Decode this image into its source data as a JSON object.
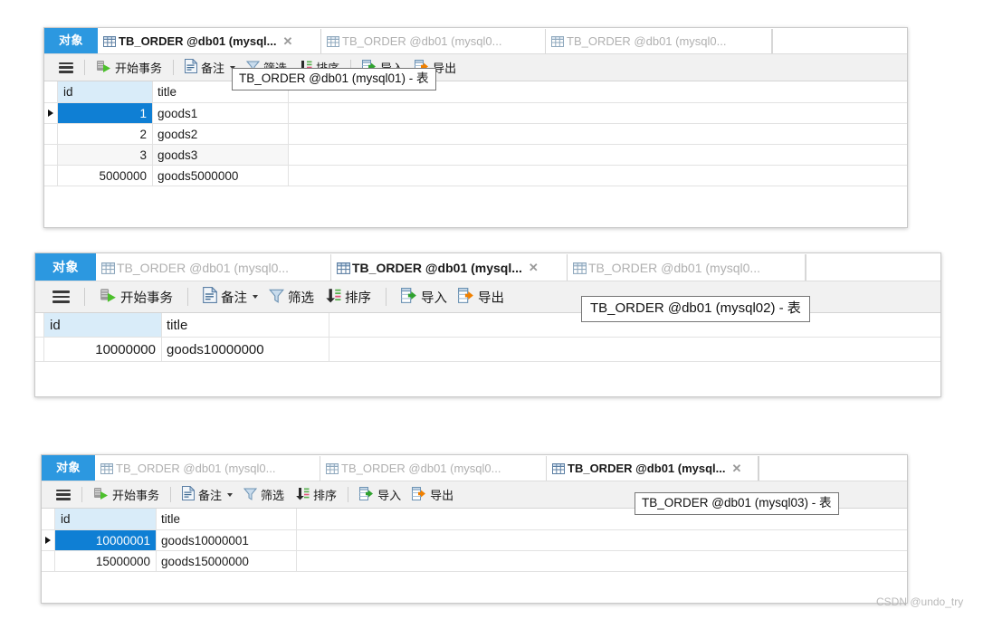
{
  "watermark": "CSDN @undo_try",
  "common": {
    "object_tab_label": "对象",
    "toolbar": {
      "menu_icon": "hamburger-menu-icon",
      "begin_transaction": "开始事务",
      "remark": "备注",
      "filter": "筛选",
      "sort": "排序",
      "import": "导入",
      "export": "导出"
    },
    "columns": [
      "id",
      "title"
    ]
  },
  "panels": [
    {
      "id": "panel-mysql01",
      "tabs": [
        {
          "label": "TB_ORDER @db01 (mysql...",
          "active": true,
          "closable": true
        },
        {
          "label": "TB_ORDER @db01 (mysql0...",
          "active": false,
          "closable": false
        },
        {
          "label": "TB_ORDER @db01 (mysql0...",
          "active": false,
          "closable": false
        }
      ],
      "tooltip": "TB_ORDER @db01 (mysql01) - 表",
      "rows": [
        {
          "id": "1",
          "title": "goods1",
          "selected": true
        },
        {
          "id": "2",
          "title": "goods2",
          "selected": false
        },
        {
          "id": "3",
          "title": "goods3",
          "selected": false
        },
        {
          "id": "5000000",
          "title": "goods5000000",
          "selected": false
        }
      ]
    },
    {
      "id": "panel-mysql02",
      "tabs": [
        {
          "label": "TB_ORDER @db01 (mysql0...",
          "active": false,
          "closable": false
        },
        {
          "label": "TB_ORDER @db01 (mysql...",
          "active": true,
          "closable": true
        },
        {
          "label": "TB_ORDER @db01 (mysql0...",
          "active": false,
          "closable": false
        }
      ],
      "tooltip": "TB_ORDER @db01 (mysql02) - 表",
      "rows": [
        {
          "id": "10000000",
          "title": "goods10000000",
          "selected": false
        }
      ]
    },
    {
      "id": "panel-mysql03",
      "tabs": [
        {
          "label": "TB_ORDER @db01 (mysql0...",
          "active": false,
          "closable": false
        },
        {
          "label": "TB_ORDER @db01 (mysql0...",
          "active": false,
          "closable": false
        },
        {
          "label": "TB_ORDER @db01 (mysql...",
          "active": true,
          "closable": true
        }
      ],
      "tooltip": "TB_ORDER @db01 (mysql03) - 表",
      "rows": [
        {
          "id": "10000001",
          "title": "goods10000001",
          "selected": true
        },
        {
          "id": "15000000",
          "title": "goods15000000",
          "selected": false
        }
      ]
    }
  ]
}
